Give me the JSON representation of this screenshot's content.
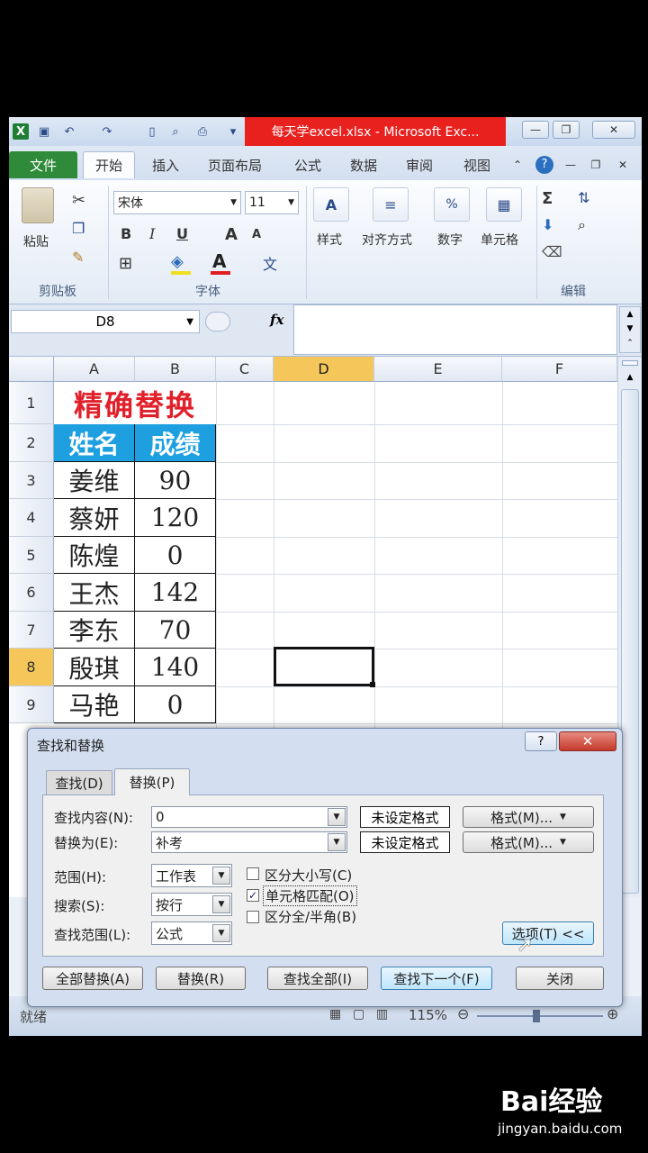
{
  "window": {
    "title": "每天学excel.xlsx - Microsoft Exc...",
    "minimize_glyph": "—",
    "restore_glyph": "❐",
    "close_glyph": "✕"
  },
  "ribbon_tabs": [
    "文件",
    "开始",
    "插入",
    "页面布局",
    "公式",
    "数据",
    "审阅",
    "视图"
  ],
  "ribbon": {
    "paste_label": "粘贴",
    "font_name": "宋体",
    "font_size": "11",
    "bold": "B",
    "italic": "I",
    "underline": "U",
    "font_grow": "A",
    "font_shrink": "A",
    "group_clipboard": "剪贴板",
    "group_font": "字体",
    "group_edit": "编辑",
    "styles": "样式",
    "alignment": "对齐方式",
    "number": "数字",
    "cells": "单元格"
  },
  "formula_bar": {
    "name_box": "D8",
    "fx": "fx",
    "formula": ""
  },
  "sheet": {
    "columns": [
      "A",
      "B",
      "C",
      "D",
      "E",
      "F"
    ],
    "selected_column": "D",
    "rows": [
      "1",
      "2",
      "3",
      "4",
      "5",
      "6",
      "7",
      "8",
      "9"
    ],
    "selected_row": "8",
    "title": "精确替换",
    "headers": [
      "姓名",
      "成绩"
    ],
    "data": [
      [
        "姜维",
        "90"
      ],
      [
        "蔡妍",
        "120"
      ],
      [
        "陈煌",
        "0"
      ],
      [
        "王杰",
        "142"
      ],
      [
        "李东",
        "70"
      ],
      [
        "殷琪",
        "140"
      ],
      [
        "马艳",
        "0"
      ]
    ]
  },
  "status": {
    "ready": "就绪",
    "zoom": "115%"
  },
  "dialog": {
    "title": "查找和替换",
    "help": "?",
    "close": "✕",
    "tabs": [
      "查找(D)",
      "替换(P)"
    ],
    "active_tab": "替换(P)",
    "find_label": "查找内容(N):",
    "find_value": "0",
    "replace_label": "替换为(E):",
    "replace_value": "补考",
    "no_format": "未设定格式",
    "format_btn": "格式(M)...",
    "within_label": "范围(H):",
    "within_value": "工作表",
    "search_label": "搜索(S):",
    "search_value": "按行",
    "lookin_label": "查找范围(L):",
    "lookin_value": "公式",
    "match_case": "区分大小写(C)",
    "match_case_checked": false,
    "match_entire": "单元格匹配(O)",
    "match_entire_checked": true,
    "match_byte": "区分全/半角(B)",
    "match_byte_checked": false,
    "options_btn": "选项(T) <<",
    "buttons": {
      "replace_all": "全部替换(A)",
      "replace": "替换(R)",
      "find_all": "查找全部(I)",
      "find_next": "查找下一个(F)",
      "close": "关闭"
    }
  },
  "watermark": {
    "logo": "Bai经验",
    "url": "jingyan.baidu.com"
  }
}
